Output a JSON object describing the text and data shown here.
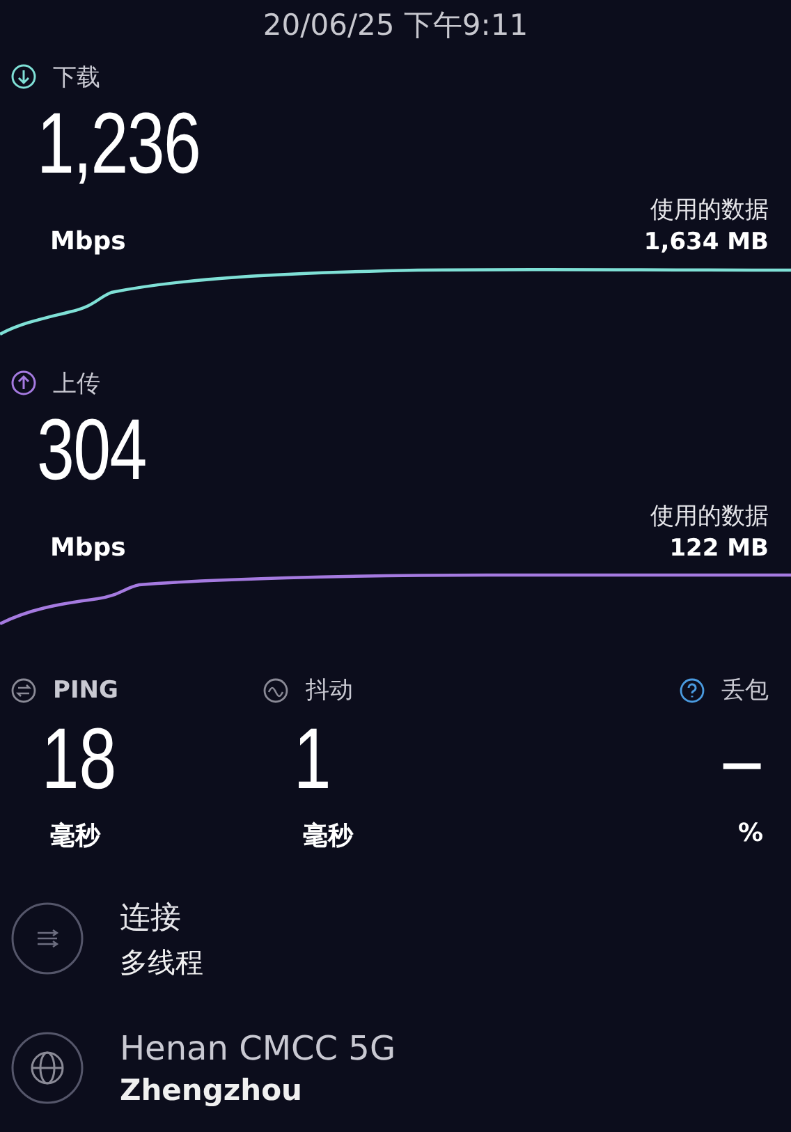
{
  "header": {
    "datetime": "20/06/25 下午9:11"
  },
  "tests": [
    {
      "kind": "download",
      "label": "下载",
      "value": "1,236",
      "unit": "Mbps",
      "data_label": "使用的数据",
      "data_value": "1,634 MB",
      "color": "#7fe0d6"
    },
    {
      "kind": "upload",
      "label": "上传",
      "value": "304",
      "unit": "Mbps",
      "data_label": "使用的数据",
      "data_value": "122 MB",
      "color": "#a57ae0"
    }
  ],
  "metrics": [
    {
      "kind": "ping",
      "label": "PING",
      "value": "18",
      "unit": "毫秒"
    },
    {
      "kind": "jitter",
      "label": "抖动",
      "value": "1",
      "unit": "毫秒"
    },
    {
      "kind": "loss",
      "label": "丢包",
      "value": "–",
      "unit": "%"
    }
  ],
  "details": [
    {
      "kind": "connections",
      "title": "连接",
      "subtitle": "多线程"
    },
    {
      "kind": "server",
      "title": "Henan CMCC 5G",
      "subtitle": "Zhengzhou"
    }
  ]
}
